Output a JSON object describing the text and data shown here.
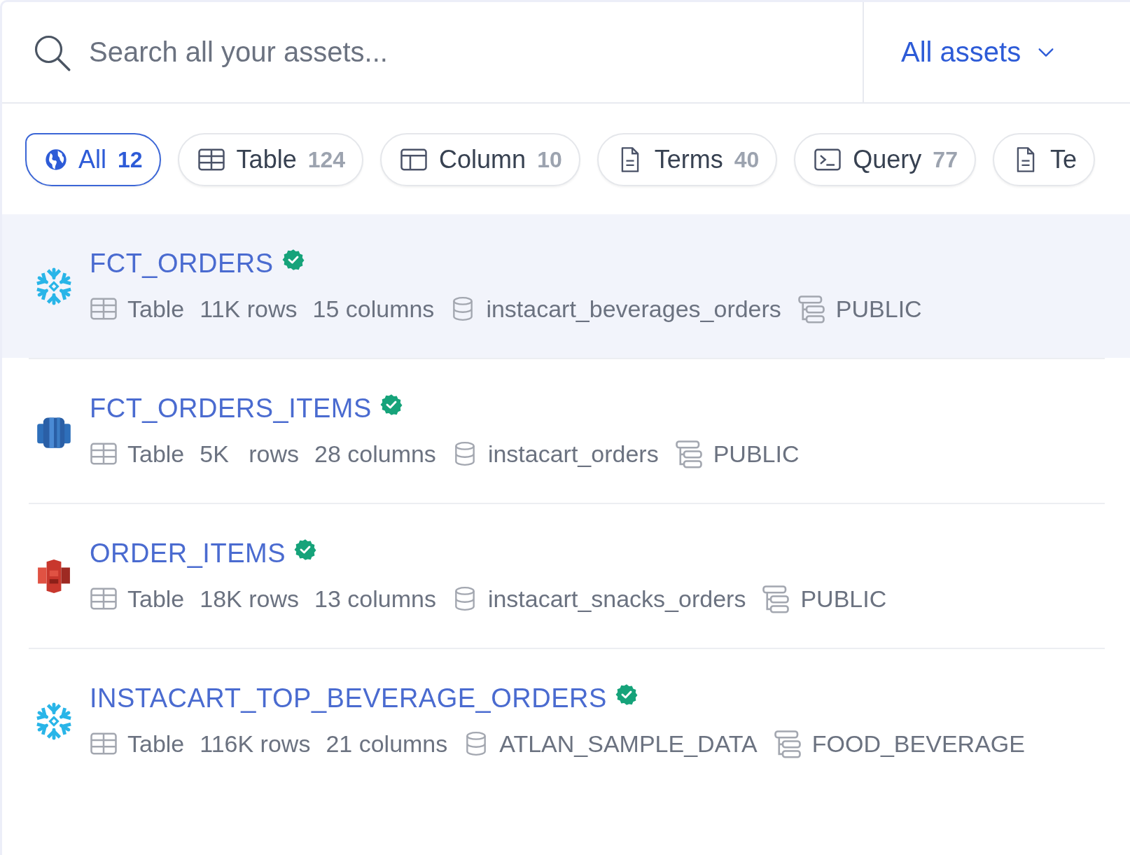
{
  "search": {
    "placeholder": "Search all your assets...",
    "scope": "All assets"
  },
  "filters": [
    {
      "label": "All",
      "count": "12",
      "kind": "all",
      "selected": true
    },
    {
      "label": "Table",
      "count": "124",
      "kind": "table",
      "selected": false
    },
    {
      "label": "Column",
      "count": "10",
      "kind": "column",
      "selected": false
    },
    {
      "label": "Terms",
      "count": "40",
      "kind": "terms",
      "selected": false
    },
    {
      "label": "Query",
      "count": "77",
      "kind": "query",
      "selected": false
    },
    {
      "label": "Te",
      "kind": "terms",
      "selected": false
    }
  ],
  "results": [
    {
      "title": "FCT_ORDERS",
      "verified": true,
      "kind": "snowflake",
      "selected": true,
      "type": "Table",
      "rows": "11K rows",
      "columns": "15 columns",
      "database": "instacart_beverages_orders",
      "schema": "PUBLIC"
    },
    {
      "title": "FCT_ORDERS_ITEMS",
      "verified": true,
      "kind": "redshift",
      "selected": false,
      "type": "Table",
      "rows": "5K   rows",
      "columns": "28 columns",
      "database": "instacart_orders",
      "schema": "PUBLIC"
    },
    {
      "title": "ORDER_ITEMS",
      "verified": true,
      "kind": "s3",
      "selected": false,
      "type": "Table",
      "rows": "18K rows",
      "columns": "13 columns",
      "database": "instacart_snacks_orders",
      "schema": "PUBLIC"
    },
    {
      "title": "INSTACART_TOP_BEVERAGE_ORDERS",
      "verified": true,
      "kind": "snowflake",
      "selected": false,
      "type": "Table",
      "rows": "116K rows",
      "columns": "21 columns",
      "database": "ATLAN_SAMPLE_DATA",
      "schema": "FOOD_BEVERAGE"
    }
  ]
}
